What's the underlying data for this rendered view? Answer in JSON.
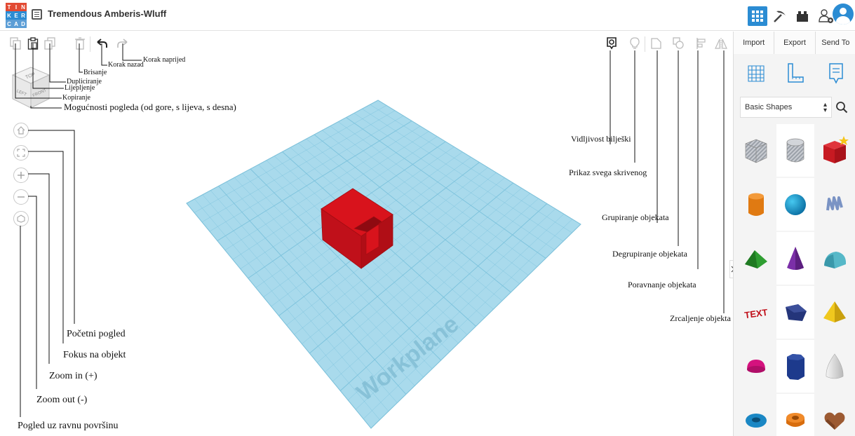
{
  "app": {
    "logo_letters": [
      "T",
      "I",
      "N",
      "K",
      "E",
      "R",
      "C",
      "A",
      "D"
    ],
    "title": "Tremendous Amberis-Wluff"
  },
  "header_icons": [
    "grid-icon",
    "pickaxe-icon",
    "brick-icon",
    "add-user-icon",
    "avatar"
  ],
  "panel": {
    "import_label": "Import",
    "export_label": "Export",
    "send_label": "Send To",
    "shape_category": "Basic Shapes",
    "shapes": [
      "box-hole",
      "cylinder-hole",
      "box",
      "cylinder",
      "sphere",
      "scribble",
      "roof",
      "cone",
      "round-roof",
      "text",
      "polygon",
      "pyramid",
      "half-sphere",
      "hexagonal-prism",
      "paraboloid",
      "torus",
      "tube",
      "heart"
    ]
  },
  "cube_labels": {
    "top": "TOP",
    "left": "LEFT",
    "front": "FRONT"
  },
  "workplane_label": "Workplane",
  "annotations": {
    "korak_naprijed": "Korak naprijed",
    "korak_nazad": "Korak nazad",
    "brisanje": "Brisanje",
    "dupliciranje": "Dupliciranje",
    "lijepljenje": "Lijepljenje",
    "kopiranje": "Kopiranje",
    "mogucnosti_pogleda": "Mogućnosti pogleda (od gore, s lijeva, s desna)",
    "vidljivost_biljeski": "Vidljivost bilješki",
    "prikaz_skrivenog": "Prikaz svega skrivenog",
    "grupiranje": "Grupiranje objekata",
    "degrupiranje": "Degrupiranje objekata",
    "poravnanje": "Poravnanje objekata",
    "zrcaljenje": "Zrcaljenje objekta",
    "pocetni_pogled": "Početni pogled",
    "fokus": "Fokus na objekt",
    "zoom_in": "Zoom in (+)",
    "zoom_out": "Zoom out (-)",
    "pogled_ravno": "Pogled uz ravnu površinu"
  },
  "colors": {
    "accent": "#2b8cd3",
    "workplane": "#9fd5e8",
    "grid_line": "#7cc2dc",
    "object_red": "#d8131c",
    "logo": [
      "#e24a33",
      "#e24a33",
      "#e24a33",
      "#2b8cd3",
      "#2b8cd3",
      "#2b8cd3",
      "#5c9ed6",
      "#5c9ed6",
      "#5c9ed6"
    ]
  }
}
